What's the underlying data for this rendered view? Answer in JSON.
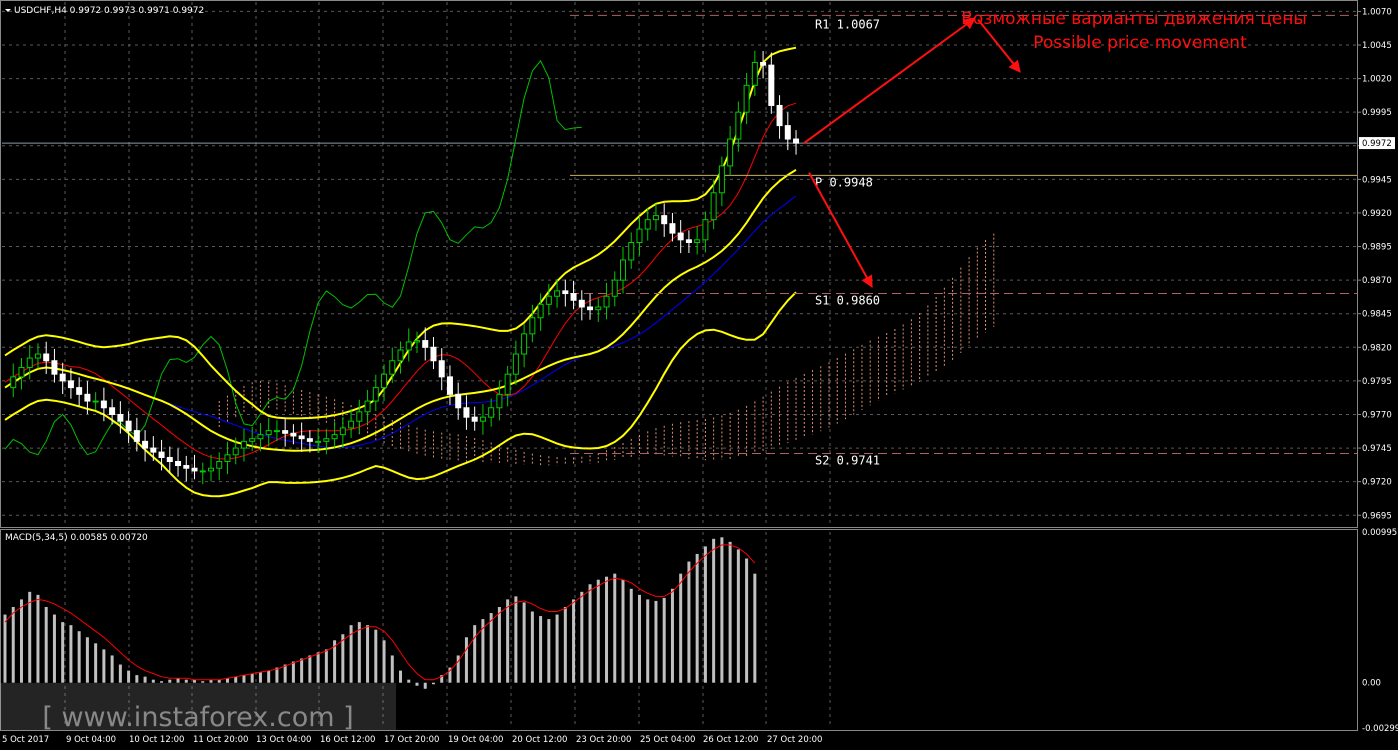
{
  "header": {
    "symbol_line": "USDCHF,H4  0.9972 0.9973 0.9971 0.9972"
  },
  "macd_header": "MACD(5,34,5) 0.00585 0.00720",
  "annotation": {
    "ru": "Возможные варианты движения цены",
    "en": "Possible price movement"
  },
  "watermark": "[ www.instaforex.com ]",
  "colors": {
    "background": "#000000",
    "grid": "#5a5a5a",
    "bull": "#00cc00",
    "bear": "#ffffff",
    "bollinger": "#ffff00",
    "tenkan": "#ff0000",
    "kijun": "#0000ff",
    "chikou": "#00c000",
    "cloud": "#e09070",
    "level_line": "#b06060",
    "pivot_line": "#c8b060",
    "annotation": "#ff1010",
    "macd_hist": "#c0c0c0",
    "macd_signal": "#ff0000",
    "axis_text": "#ffffff"
  },
  "chart_data": [
    {
      "type": "line",
      "title": "USDCHF,H4",
      "current_price": "0.9972",
      "ylim": [
        0.9687,
        1.0077
      ],
      "y_ticks": [
        "1.0070",
        "1.0045",
        "1.0020",
        "0.9995",
        "0.9970",
        "0.9945",
        "0.9920",
        "0.9895",
        "0.9870",
        "0.9845",
        "0.9820",
        "0.9795",
        "0.9770",
        "0.9745",
        "0.9720",
        "0.9695"
      ],
      "x_ticks": [
        "5 Oct 2017",
        "9 Oct 04:00",
        "10 Oct 12:00",
        "11 Oct 20:00",
        "13 Oct 04:00",
        "16 Oct 12:00",
        "17 Oct 20:00",
        "19 Oct 04:00",
        "20 Oct 12:00",
        "23 Oct 20:00",
        "25 Oct 04:00",
        "26 Oct 12:00",
        "27 Oct 20:00"
      ],
      "levels": [
        {
          "name": "R1",
          "value": 1.0067,
          "label": "R1  1.0067"
        },
        {
          "name": "P",
          "value": 0.9948,
          "label": "P  0.9948"
        },
        {
          "name": "S1",
          "value": 0.986,
          "label": "S1  0.9860"
        },
        {
          "name": "S2",
          "value": 0.9741,
          "label": "S2  0.9741"
        }
      ],
      "close_series": [
        0.979,
        0.9798,
        0.9805,
        0.9812,
        0.9815,
        0.981,
        0.98,
        0.9795,
        0.979,
        0.9785,
        0.978,
        0.978,
        0.9775,
        0.977,
        0.9765,
        0.9758,
        0.975,
        0.9745,
        0.9742,
        0.9738,
        0.9735,
        0.9732,
        0.973,
        0.9728,
        0.9728,
        0.973,
        0.9735,
        0.974,
        0.9745,
        0.975,
        0.9752,
        0.9755,
        0.9758,
        0.9758,
        0.9756,
        0.9754,
        0.9752,
        0.975,
        0.975,
        0.9752,
        0.9755,
        0.976,
        0.9765,
        0.9772,
        0.978,
        0.979,
        0.98,
        0.981,
        0.9818,
        0.9824,
        0.9825,
        0.982,
        0.981,
        0.9798,
        0.9785,
        0.9775,
        0.9768,
        0.9765,
        0.9768,
        0.9775,
        0.9785,
        0.98,
        0.9815,
        0.983,
        0.9842,
        0.9852,
        0.9858,
        0.9862,
        0.986,
        0.9855,
        0.985,
        0.9848,
        0.985,
        0.9858,
        0.987,
        0.9885,
        0.9898,
        0.9908,
        0.9915,
        0.9918,
        0.9912,
        0.9905,
        0.99,
        0.9898,
        0.99,
        0.9915,
        0.9935,
        0.9955,
        0.9975,
        0.9995,
        1.0015,
        1.0032,
        1.003,
        1.0,
        0.9985,
        0.9975,
        0.9972
      ],
      "macd_ylim": [
        -0.00299,
        0.00995
      ],
      "macd_ticks": [
        "0.00995",
        "0.00",
        "-0.00299"
      ],
      "macd_hist": [
        0.0045,
        0.005,
        0.0055,
        0.006,
        0.0058,
        0.005,
        0.0045,
        0.004,
        0.0038,
        0.0034,
        0.003,
        0.0026,
        0.0022,
        0.0018,
        0.0012,
        0.0008,
        0.0005,
        0.0004,
        0.0002,
        0.0001,
        0.0002,
        0.0003,
        0.0002,
        0.0002,
        0.0001,
        0.0002,
        0.0002,
        0.0003,
        0.0004,
        0.0005,
        0.0006,
        0.0007,
        0.0008,
        0.001,
        0.0012,
        0.0014,
        0.0016,
        0.0018,
        0.002,
        0.0022,
        0.0028,
        0.0032,
        0.0038,
        0.004,
        0.0038,
        0.0035,
        0.0028,
        0.0018,
        0.0008,
        0.0002,
        -0.0002,
        -0.0004,
        -0.0001,
        0.0005,
        0.001,
        0.0018,
        0.003,
        0.0038,
        0.0042,
        0.0046,
        0.005,
        0.0055,
        0.0057,
        0.0053,
        0.0047,
        0.0044,
        0.0042,
        0.0045,
        0.005,
        0.0055,
        0.006,
        0.0065,
        0.0068,
        0.007,
        0.0072,
        0.0068,
        0.0062,
        0.0058,
        0.0055,
        0.0054,
        0.0056,
        0.0062,
        0.0072,
        0.008,
        0.0085,
        0.009,
        0.0095,
        0.0096,
        0.0093,
        0.0088,
        0.0082,
        0.0072
      ],
      "macd_signal": [
        0.004,
        0.0046,
        0.005,
        0.0053,
        0.0055,
        0.0054,
        0.0052,
        0.0049,
        0.0046,
        0.0042,
        0.0038,
        0.0034,
        0.003,
        0.0025,
        0.002,
        0.0015,
        0.0011,
        0.0008,
        0.0006,
        0.0004,
        0.0003,
        0.0003,
        0.0003,
        0.0002,
        0.0002,
        0.0002,
        0.0002,
        0.0003,
        0.0004,
        0.0005,
        0.0006,
        0.0007,
        0.0008,
        0.0009,
        0.0011,
        0.0013,
        0.0015,
        0.0017,
        0.0019,
        0.0021,
        0.0024,
        0.0028,
        0.0032,
        0.0035,
        0.0037,
        0.0037,
        0.0034,
        0.0028,
        0.002,
        0.0012,
        0.0006,
        0.0002,
        0.0002,
        0.0004,
        0.0008,
        0.0014,
        0.0022,
        0.003,
        0.0036,
        0.0041,
        0.0046,
        0.005,
        0.0053,
        0.0054,
        0.0052,
        0.0049,
        0.0047,
        0.0047,
        0.0049,
        0.0053,
        0.0057,
        0.0061,
        0.0064,
        0.0067,
        0.0069,
        0.0068,
        0.0066,
        0.0062,
        0.0059,
        0.0057,
        0.0057,
        0.006,
        0.0066,
        0.0073,
        0.0079,
        0.0084,
        0.0088,
        0.0091,
        0.0091,
        0.0089,
        0.0085,
        0.0079
      ]
    }
  ]
}
